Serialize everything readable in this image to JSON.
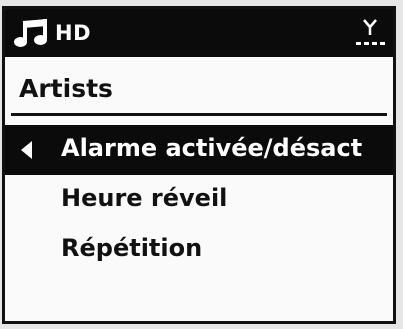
{
  "status_bar": {
    "source_icon": "music-note-icon",
    "source_label": "HD",
    "signal_icon": "antenna-signal-icon"
  },
  "header": {
    "title": "Artists"
  },
  "menu": {
    "selected_indicator_icon": "left-arrow-icon",
    "items": [
      {
        "label": "Alarme activée/désact",
        "selected": true
      },
      {
        "label": "Heure réveil",
        "selected": false
      },
      {
        "label": "Répétition",
        "selected": false
      }
    ]
  },
  "colors": {
    "screen_background": "#fafafa",
    "bar_background": "#0b0b0b",
    "text_dark": "#111111",
    "text_light": "#ffffff",
    "bezel": "#e6e6e6"
  }
}
